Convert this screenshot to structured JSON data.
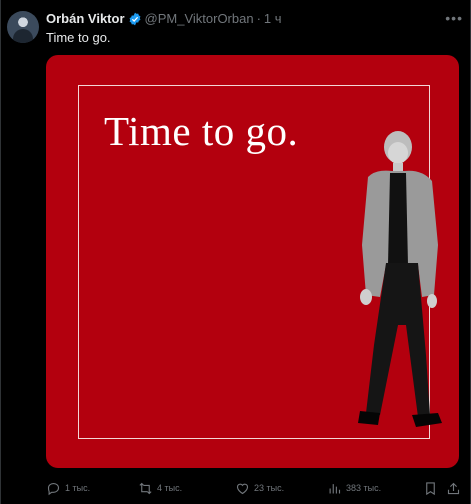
{
  "tweet": {
    "author_name": "Orbán Viktor",
    "author_handle": "@PM_ViktorOrban",
    "separator": "·",
    "time": "1 ч",
    "text": "Time to go.",
    "image_caption": "Time to go."
  },
  "actions": {
    "replies": "1 тыс.",
    "retweets": "4 тыс.",
    "likes": "23 тыс.",
    "views": "383 тыс."
  },
  "colors": {
    "background": "#000000",
    "poster_red": "#b3000e",
    "verified_blue": "#1d9bf0",
    "muted": "#71767b"
  }
}
